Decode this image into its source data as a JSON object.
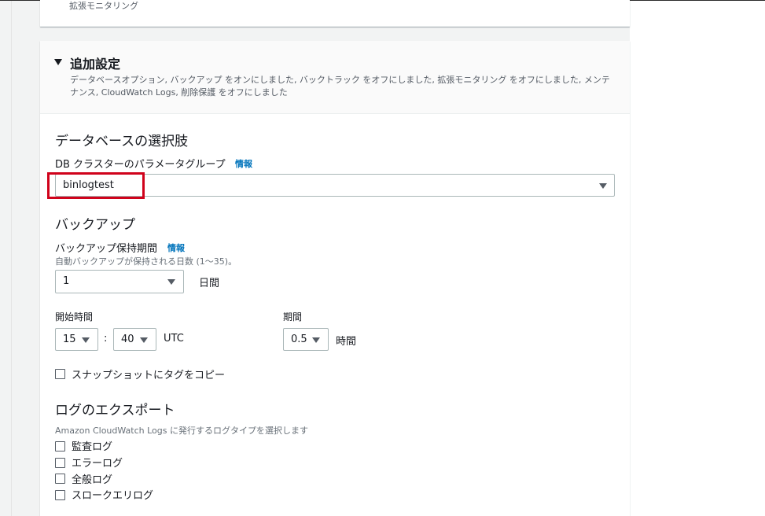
{
  "top_card": {
    "partial_text": "拡張モニタリング"
  },
  "additional_settings": {
    "title": "追加設定",
    "description": "データベースオプション, バックアップ をオンにしました, バックトラック をオフにしました, 拡張モニタリング をオフにしました, メンテナンス, CloudWatch Logs, 削除保護 をオフにしました"
  },
  "db_options": {
    "section_title": "データベースの選択肢",
    "param_group_label": "DB クラスターのパラメータグループ",
    "info_label": "情報",
    "param_group_value": "binlogtest"
  },
  "backup": {
    "section_title": "バックアップ",
    "retention_label": "バックアップ保持期間",
    "info_label": "情報",
    "retention_hint": "自動バックアップが保持される日数 (1〜35)。",
    "retention_value": "1",
    "retention_unit": "日間",
    "start_time_label": "開始時間",
    "start_hour": "15",
    "colon": ":",
    "start_minute": "40",
    "timezone": "UTC",
    "duration_label": "期間",
    "duration_value": "0.5",
    "duration_unit": "時間",
    "copy_tags_label": "スナップショットにタグをコピー"
  },
  "log_exports": {
    "section_title": "ログのエクスポート",
    "hint": "Amazon CloudWatch Logs に発行するログタイプを選択します",
    "options": [
      "監査ログ",
      "エラーログ",
      "全般ログ",
      "スロークエリログ"
    ]
  },
  "colors": {
    "highlight_border": "#d0021b",
    "link": "#0073bb"
  }
}
